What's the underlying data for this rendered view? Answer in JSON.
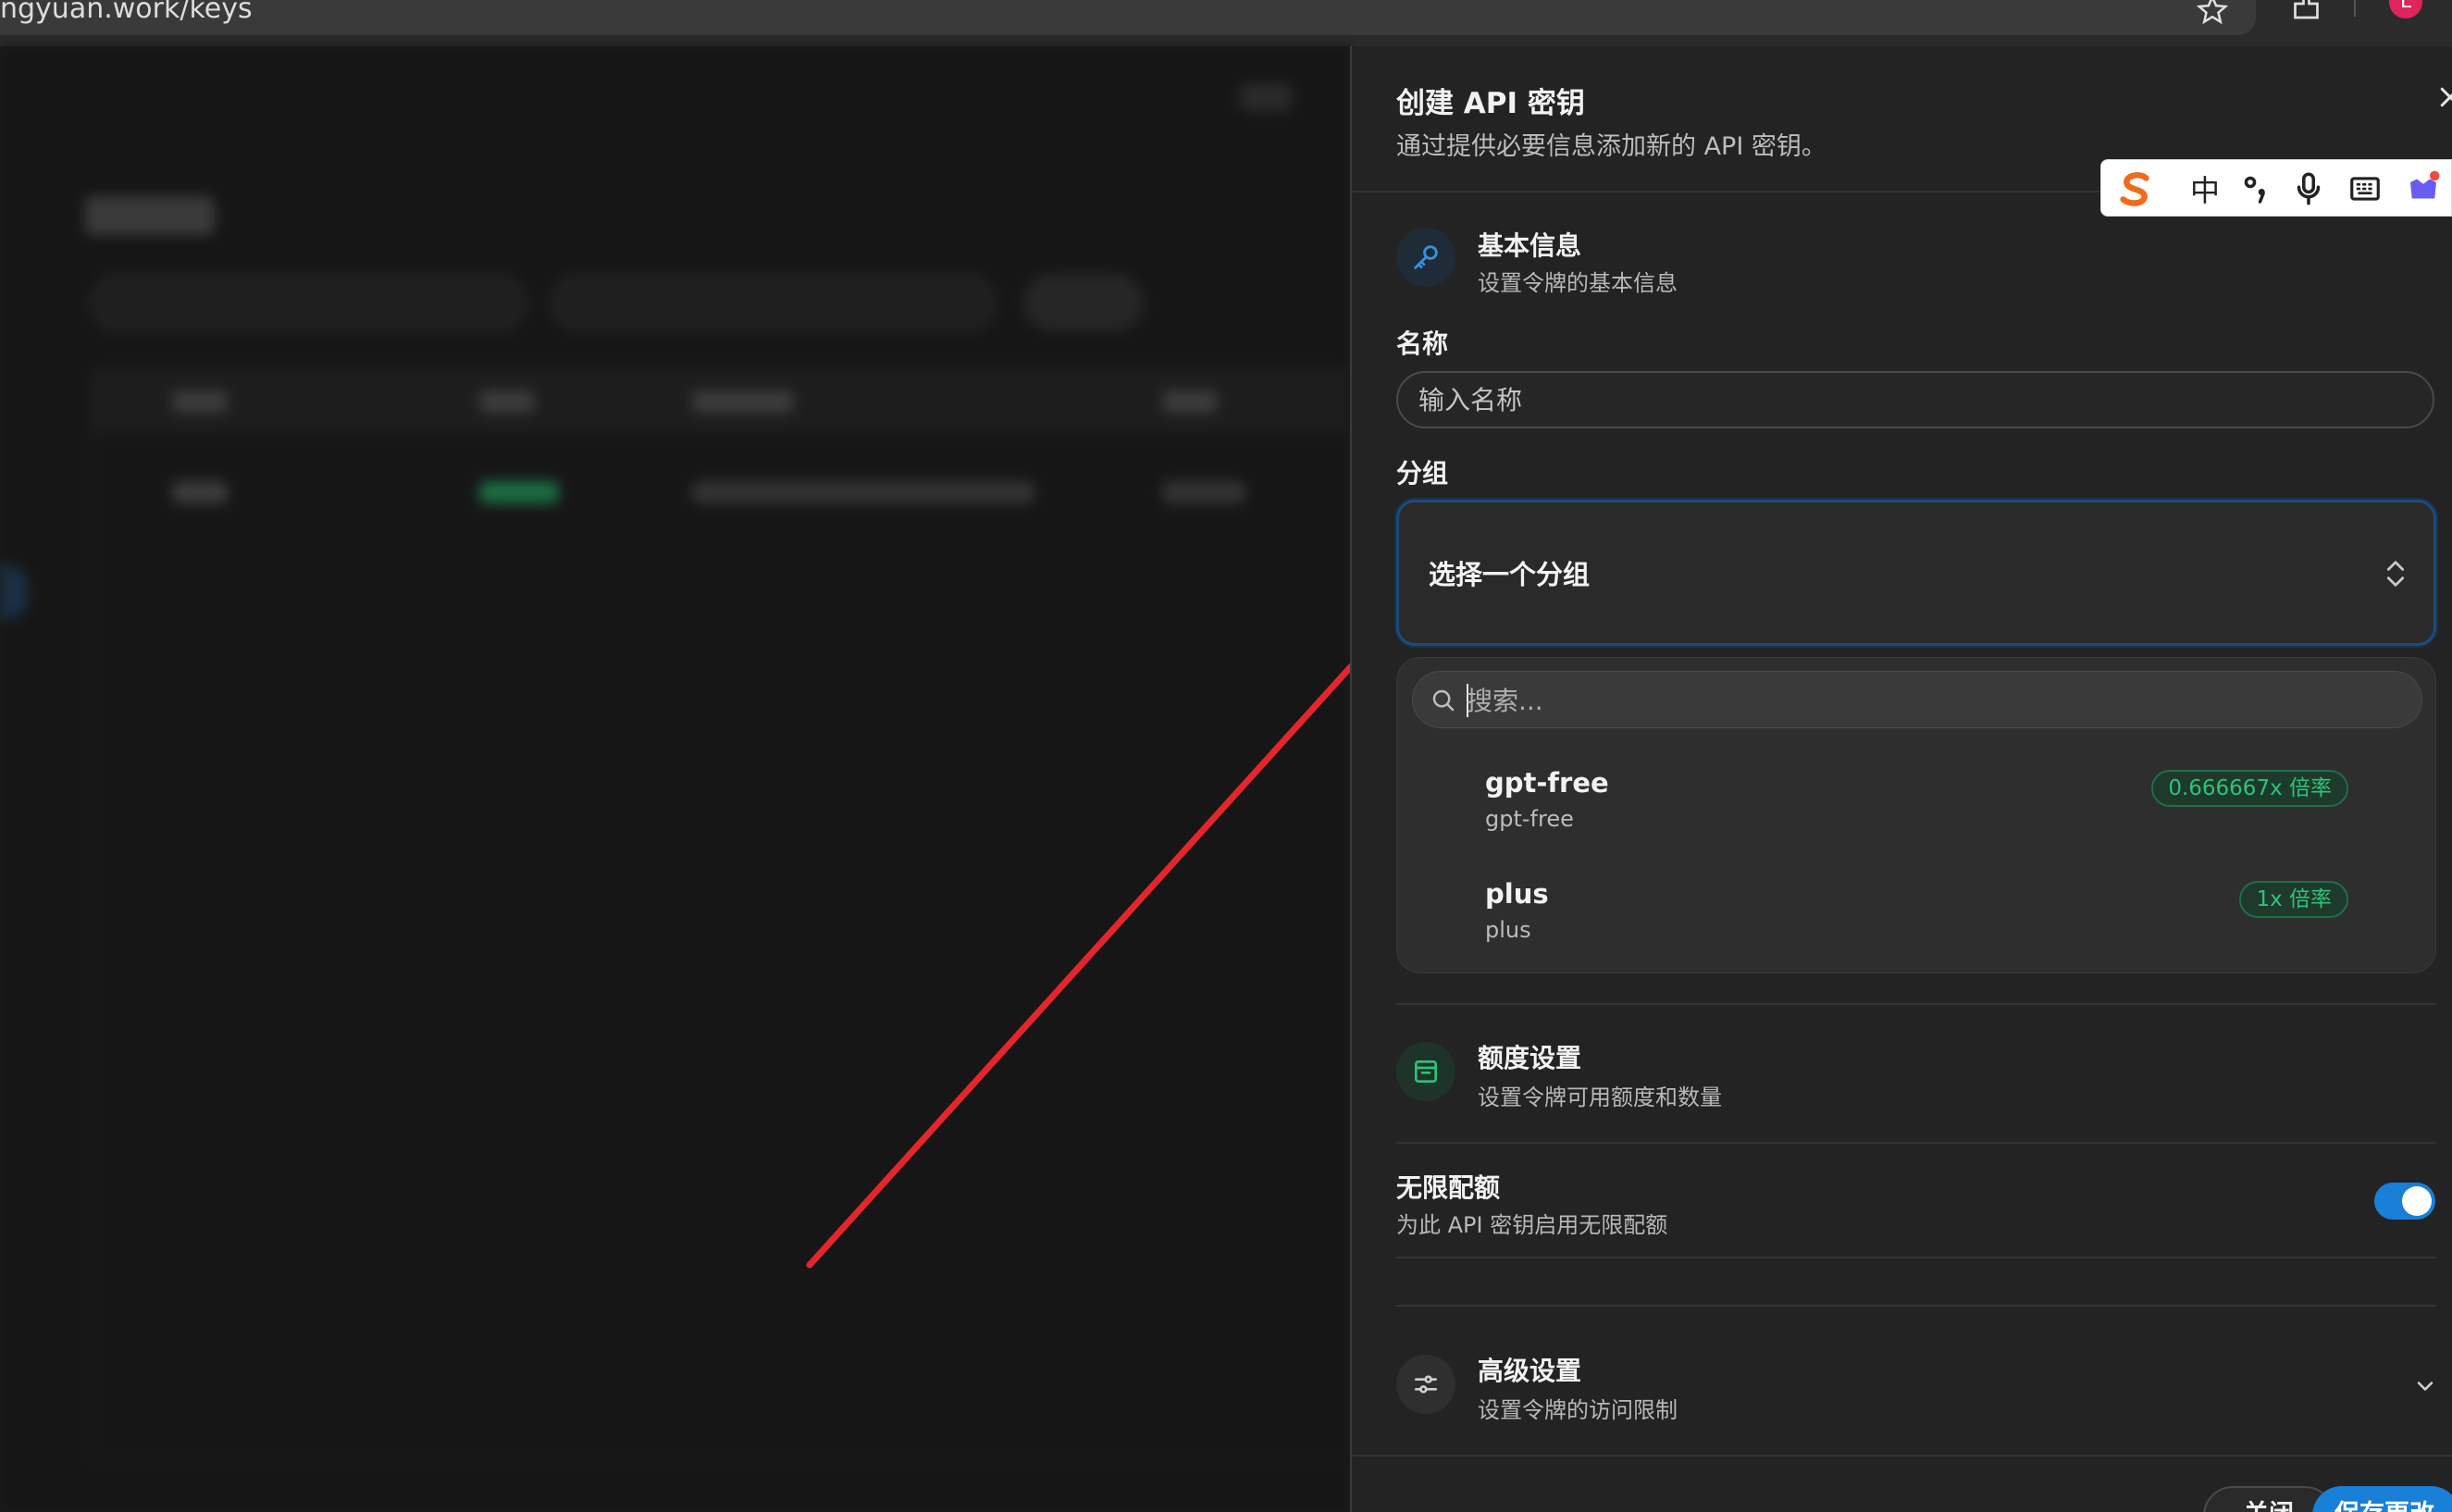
{
  "browser": {
    "url": "ngyuan.work/keys",
    "avatar_letter": "L",
    "avatar_color": "#e0245e"
  },
  "ime": {
    "chinese_mode": "中"
  },
  "drawer": {
    "title": "创建 API 密钥",
    "subtitle": "通过提供必要信息添加新的 API 密钥。",
    "basic_section": {
      "title": "基本信息",
      "subtitle": "设置令牌的基本信息"
    },
    "name_field": {
      "label": "名称",
      "placeholder": "输入名称"
    },
    "group_field": {
      "label": "分组",
      "placeholder": "选择一个分组"
    },
    "dropdown": {
      "search_placeholder": "搜索...",
      "options": [
        {
          "name": "gpt-free",
          "sub": "gpt-free",
          "ratio": "0.666667x 倍率"
        },
        {
          "name": "plus",
          "sub": "plus",
          "ratio": "1x 倍率"
        }
      ]
    },
    "quota_section": {
      "title": "额度设置",
      "subtitle": "设置令牌可用额度和数量"
    },
    "unlimited": {
      "title": "无限配额",
      "subtitle": "为此 API 密钥启用无限配额",
      "enabled": true
    },
    "advanced_section": {
      "title": "高级设置",
      "subtitle": "设置令牌的访问限制"
    },
    "footer": {
      "close_label": "关闭",
      "save_label": "保存更改"
    }
  },
  "colors": {
    "accent": "#1a7fd6",
    "badge_green": "#2fc27a",
    "annotation_arrow": "#e3262b"
  }
}
